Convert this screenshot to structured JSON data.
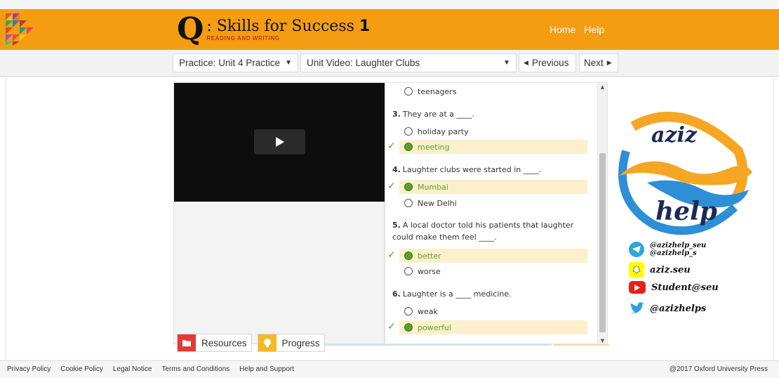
{
  "header": {
    "brand_q": "Q",
    "brand_title_a": ": Skills for Success",
    "brand_title_b": "1",
    "brand_subtitle": "READING AND WRITING",
    "nav": {
      "home": "Home",
      "help": "Help"
    },
    "color": "#f49c12"
  },
  "toolbar": {
    "practice_select": "Practice: Unit 4 Practice",
    "video_select": "Unit Video: Laughter Clubs",
    "previous_label": "Previous",
    "next_label": "Next"
  },
  "quiz": {
    "items": [
      {
        "option": "teenagers",
        "selected": false,
        "correct": false
      },
      {
        "num": "3.",
        "text": "They are at a ____."
      },
      {
        "option": "holiday party",
        "selected": false,
        "correct": false
      },
      {
        "option": "meeting",
        "selected": true,
        "correct": true
      },
      {
        "num": "4.",
        "text": "Laughter clubs were started in ____."
      },
      {
        "option": "Mumbai",
        "selected": true,
        "correct": true
      },
      {
        "option": "New Delhi",
        "selected": false,
        "correct": false
      },
      {
        "num": "5.",
        "text": "A local doctor told his patients that laughter could make them feel ____."
      },
      {
        "option": "better",
        "selected": true,
        "correct": true
      },
      {
        "option": "worse",
        "selected": false,
        "correct": false
      },
      {
        "num": "6.",
        "text": "Laughter is a ____ medicine."
      },
      {
        "option": "weak",
        "selected": false,
        "correct": false
      },
      {
        "option": "powerful",
        "selected": true,
        "correct": true
      }
    ],
    "correct_color": "#5aa227",
    "highlight_color": "#fcf0cc"
  },
  "tools": {
    "resources": "Resources",
    "progress": "Progress"
  },
  "watermark": {
    "word1": "aziz",
    "word2": "help",
    "telegram_1": "@azizhelp_seu",
    "telegram_2": "@azizhelp_s",
    "snapchat": "aziz.seu",
    "youtube": "Student@seu",
    "twitter": "@azizhelps"
  },
  "footer": {
    "links": [
      "Privacy Policy",
      "Cookie Policy",
      "Legal Notice",
      "Terms and Conditions",
      "Help and Support"
    ],
    "copyright": "@2017 Oxford University Press"
  }
}
